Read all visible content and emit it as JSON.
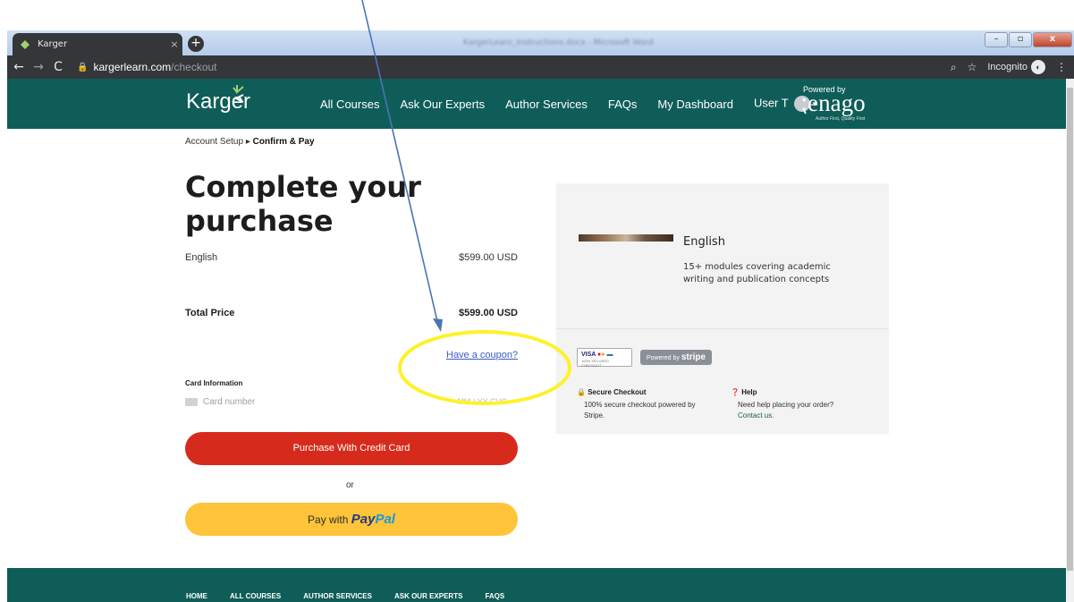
{
  "browser": {
    "tab_title": "Karger",
    "tab_close": "×",
    "new_tab": "+",
    "window_title": "KargerLearn_Instructions.docx - Microsoft Word",
    "url_domain": "kargerlearn.com",
    "url_path": "/checkout",
    "incognito_label": "Incognito",
    "icons": [
      "back-arrow",
      "forward-arrow",
      "reload",
      "lock",
      "zoom",
      "star",
      "incognito",
      "menu"
    ]
  },
  "header": {
    "logo": "Karger",
    "nav": [
      "All Courses",
      "Ask Our Experts",
      "Author Services",
      "FAQs",
      "My Dashboard"
    ],
    "user": "User T",
    "powered_by": "Powered by",
    "partner_brand": "enago",
    "partner_tagline": "Author First, Quality First",
    "colors": {
      "header_bg": "#0f5d58",
      "logo_accent": "#9ed36b"
    }
  },
  "breadcrumb": {
    "step1": "Account Setup",
    "step2": "Confirm & Pay"
  },
  "checkout": {
    "title": "Complete your purchase",
    "line_item": {
      "name": "English",
      "price": "$599.00 USD"
    },
    "total": {
      "label": "Total Price",
      "price": "$599.00 USD"
    },
    "coupon_link": "Have a coupon?",
    "card_label": "Card Information",
    "card_placeholder": "Card number",
    "card_expiry_cvc": "MM / YY  CVC",
    "pay_card_button": "Purchase With Credit Card",
    "or": "or",
    "paypal_prefix": "Pay with",
    "paypal_brand_1": "Pay",
    "paypal_brand_2": "Pal",
    "colors": {
      "card_button": "#d62b1c",
      "paypal_button": "#ffc439",
      "coupon": "#3b5cc4"
    }
  },
  "summary": {
    "product_title": "English",
    "product_desc": "15+ modules covering academic writing and publication concepts",
    "card_badge": "VISA",
    "card_badge_sub": "100% SECURED CHECKOUT",
    "stripe_prefix": "Powered by",
    "stripe_brand": "stripe",
    "secure_title": "Secure Checkout",
    "secure_body": "100% secure checkout powered by Stripe.",
    "help_title": "Help",
    "help_body": "Need help placing your order?",
    "help_link": "Contact us."
  },
  "footer": {
    "nav": [
      "HOME",
      "ALL COURSES",
      "AUTHOR SERVICES",
      "ASK OUR EXPERTS",
      "FAQS"
    ]
  }
}
